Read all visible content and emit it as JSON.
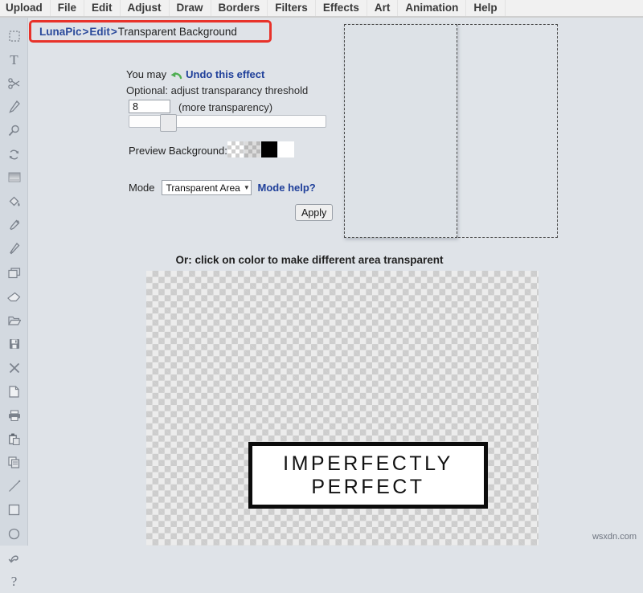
{
  "menu": {
    "items": [
      {
        "label": "Upload",
        "name": "menu-upload"
      },
      {
        "label": "File",
        "name": "menu-file"
      },
      {
        "label": "Edit",
        "name": "menu-edit"
      },
      {
        "label": "Adjust",
        "name": "menu-adjust"
      },
      {
        "label": "Draw",
        "name": "menu-draw"
      },
      {
        "label": "Borders",
        "name": "menu-borders"
      },
      {
        "label": "Filters",
        "name": "menu-filters"
      },
      {
        "label": "Effects",
        "name": "menu-effects"
      },
      {
        "label": "Art",
        "name": "menu-art"
      },
      {
        "label": "Animation",
        "name": "menu-animation"
      },
      {
        "label": "Help",
        "name": "menu-help"
      }
    ]
  },
  "toolbar": {
    "tools": [
      {
        "icon": "marquee-select-icon",
        "title": "Select"
      },
      {
        "icon": "text-icon",
        "title": "Text"
      },
      {
        "icon": "scissors-icon",
        "title": "Cut"
      },
      {
        "icon": "pencil-icon",
        "title": "Pencil"
      },
      {
        "icon": "magnifier-icon",
        "title": "Zoom"
      },
      {
        "icon": "rotate-icon",
        "title": "Rotate"
      },
      {
        "icon": "gradient-icon",
        "title": "Gradient"
      },
      {
        "icon": "paint-bucket-icon",
        "title": "Fill"
      },
      {
        "icon": "eyedropper-icon",
        "title": "Color Picker"
      },
      {
        "icon": "brush-icon",
        "title": "Brush"
      },
      {
        "icon": "layers-icon",
        "title": "Layers"
      },
      {
        "icon": "eraser-icon",
        "title": "Eraser"
      },
      {
        "icon": "folder-open-icon",
        "title": "Open"
      },
      {
        "icon": "save-icon",
        "title": "Save"
      },
      {
        "icon": "close-icon",
        "title": "Close"
      },
      {
        "icon": "new-file-icon",
        "title": "New"
      },
      {
        "icon": "printer-icon",
        "title": "Print"
      },
      {
        "icon": "paste-icon",
        "title": "Paste"
      },
      {
        "icon": "copy-icon",
        "title": "Copy"
      },
      {
        "icon": "line-icon",
        "title": "Line"
      },
      {
        "icon": "rectangle-icon",
        "title": "Rectangle"
      },
      {
        "icon": "circle-icon",
        "title": "Circle"
      },
      {
        "icon": "undo-arrow-icon",
        "title": "Undo"
      },
      {
        "icon": "question-mark-icon",
        "title": "Help"
      }
    ]
  },
  "breadcrumb": {
    "root": "LunaPic",
    "separator_1": ">",
    "section": "Edit",
    "separator_2": ">",
    "current": "Transparent Background",
    "highlight_color": "#e8322a"
  },
  "panel": {
    "undo_prefix": "You may",
    "undo_link": "Undo this effect",
    "undo_icon": "green-undo-arrow-icon",
    "optional_label": "Optional: adjust transparancy threshold",
    "threshold_value": "8",
    "threshold_hint": "(more transparency)",
    "slider_position_percent": 17,
    "preview_bg_label": "Preview Background:",
    "swatches": [
      {
        "name": "swatch-transparent",
        "type": "checker"
      },
      {
        "name": "swatch-gray",
        "type": "gray"
      },
      {
        "name": "swatch-black",
        "color": "#000000"
      },
      {
        "name": "swatch-white",
        "color": "#ffffff"
      }
    ],
    "mode_label": "Mode",
    "mode_value": "Transparent Area",
    "mode_caret": "▼",
    "mode_help_link": "Mode help?",
    "apply_label": "Apply"
  },
  "canvas": {
    "caption": "Or: click on color to make different area transparent",
    "sign_line_1": "IMPERFECTLY",
    "sign_line_2": "PERFECT"
  },
  "watermark": "wsxdn.com"
}
